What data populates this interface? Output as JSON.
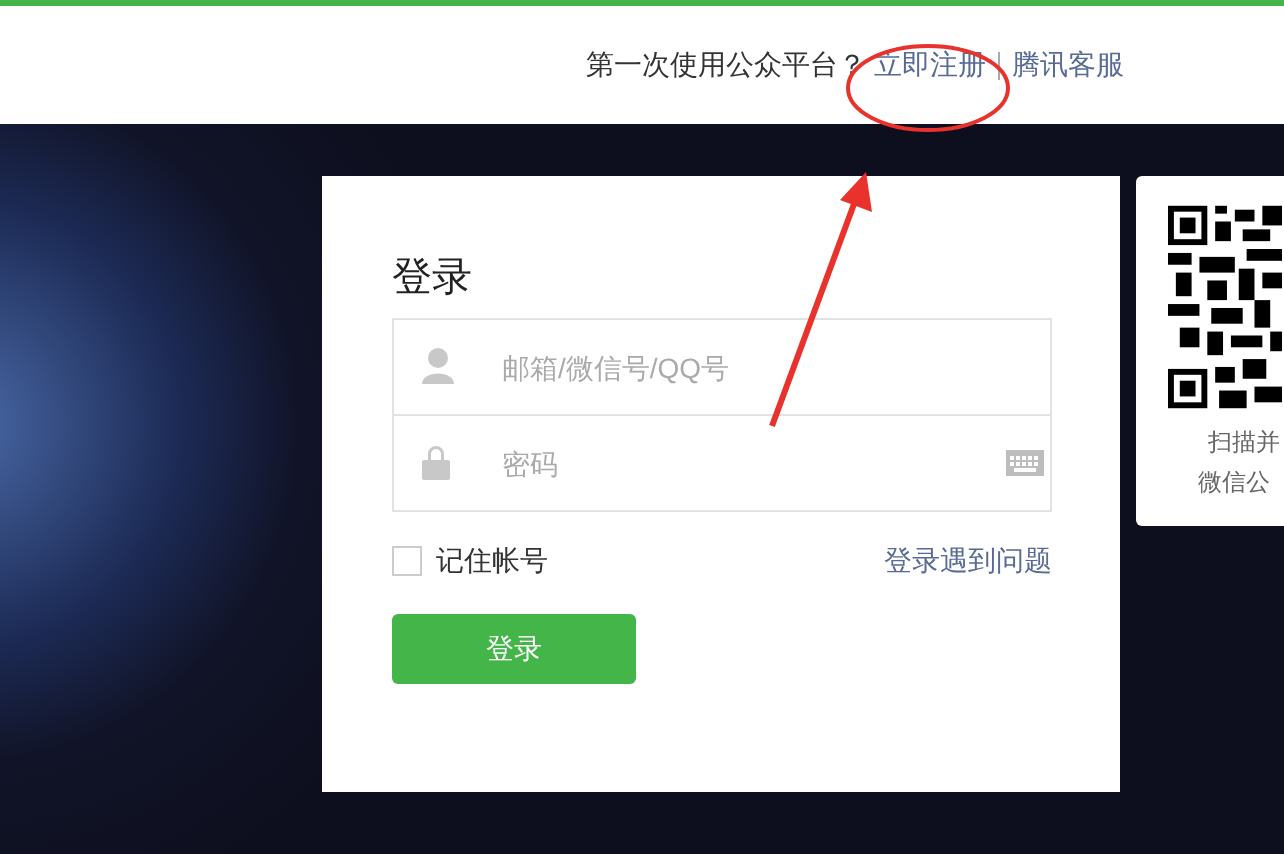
{
  "header": {
    "prompt": "第一次使用公众平台？",
    "links": [
      {
        "label": "立即注册"
      },
      {
        "label": "腾讯客服"
      }
    ]
  },
  "login": {
    "title": "登录",
    "fields": [
      {
        "kind": "account",
        "placeholder": "邮箱/微信号/QQ号"
      },
      {
        "kind": "password",
        "placeholder": "密码"
      }
    ],
    "remember": {
      "label": "记住帐号",
      "checked": false
    },
    "help_link": "登录遇到问题",
    "submit": "登录"
  },
  "qr_panel": {
    "lines": [
      "扫描并",
      "微信公"
    ]
  }
}
